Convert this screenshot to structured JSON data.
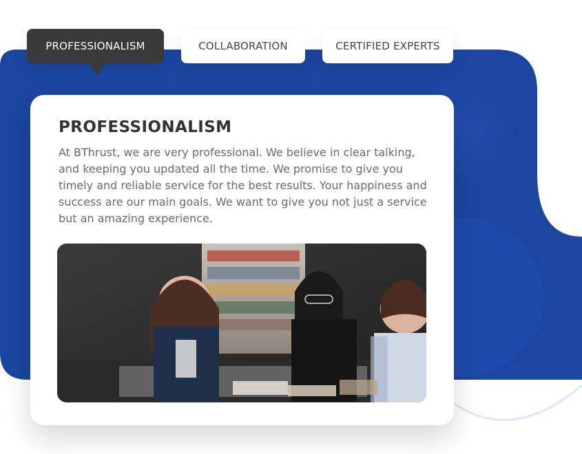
{
  "tabs": [
    {
      "label": "PROFESSIONALISM"
    },
    {
      "label": "COLLABORATION"
    },
    {
      "label": "CERTIFIED EXPERTS"
    }
  ],
  "content": {
    "title": "PROFESSIONALISM",
    "body": "At BThrust, we are very professional. We believe in clear talking, and keeping you updated all the time. We promise to give you timely and reliable service for the best results. Your happiness and success are our main goals. We want to give you not just a service but an amazing experience."
  },
  "colors": {
    "brand_blue": "#1B46A0",
    "tab_active_bg": "#3A3A3A",
    "tab_inactive_bg": "#FFFFFF"
  }
}
